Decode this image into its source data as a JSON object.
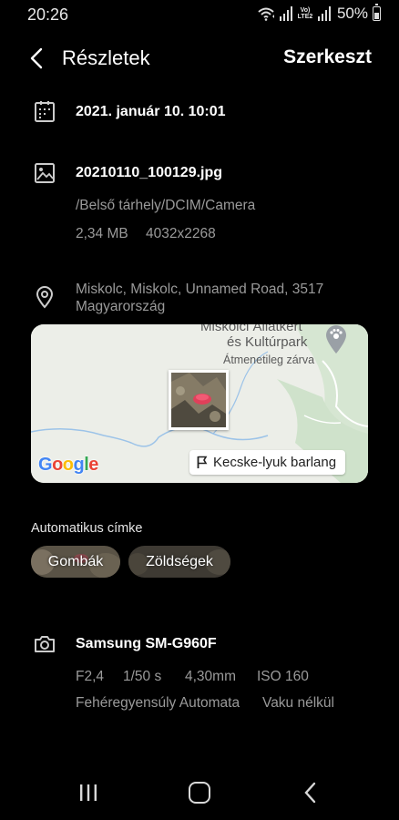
{
  "status": {
    "time": "20:26",
    "network": "Vo) LTE2",
    "battery": "50%",
    "battery_level": 0.5,
    "icons": [
      "wifi-icon",
      "signal-icon",
      "battery-icon"
    ]
  },
  "header": {
    "title": "Részletek",
    "edit": "Szerkeszt"
  },
  "details": {
    "date": "2021. január 10. 10:01",
    "filename": "20210110_100129.jpg",
    "path": "/Belső tárhely/DCIM/Camera",
    "size": "2,34 MB",
    "resolution": "4032x2268",
    "location_line1": "Miskolc, Miskolc, Unnamed Road, 3517",
    "location_line2": "Magyarország"
  },
  "map": {
    "poi_name_line1": "Miskolci Állatkert",
    "poi_name_line2": "és Kultúrpark",
    "poi_status": "Átmenetileg zárva",
    "google_letters": [
      "G",
      "o",
      "o",
      "g",
      "l",
      "e"
    ],
    "google_colors": [
      "#4285F4",
      "#EA4335",
      "#FBBC05",
      "#4285F4",
      "#34A853",
      "#EA4335"
    ],
    "place_button": "Kecske-lyuk barlang"
  },
  "tags": {
    "label": "Automatikus címke",
    "items": [
      "Gombák",
      "Zöldségek"
    ]
  },
  "camera": {
    "model": "Samsung SM-G960F",
    "aperture": "F2,4",
    "shutter": "1/50 s",
    "focal": "4,30mm",
    "iso": "ISO 160",
    "white_balance": "Fehéregyensúly Automata",
    "flash": "Vaku nélkül"
  },
  "colors": {
    "background": "#000000",
    "secondary_text": "#9a9a9a",
    "map_bg": "#eceee8"
  }
}
